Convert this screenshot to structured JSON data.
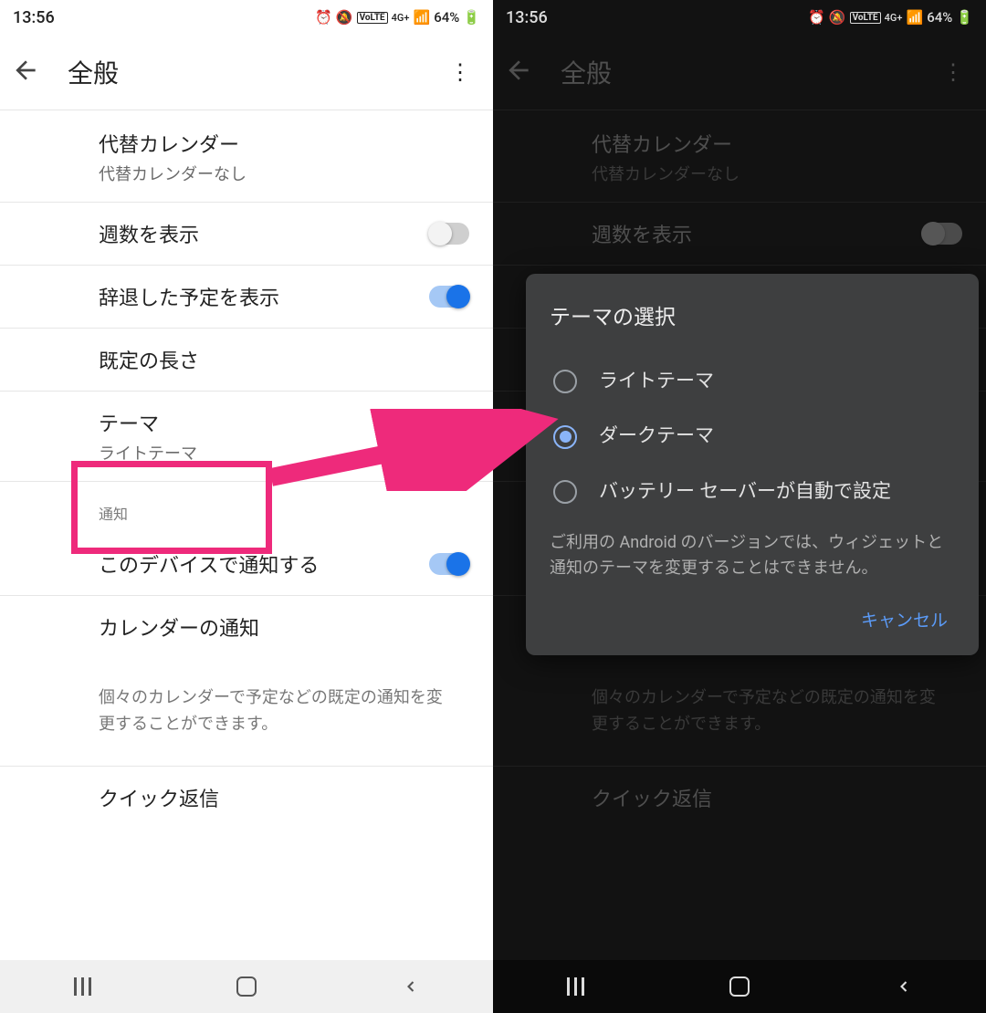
{
  "status": {
    "time": "13:56",
    "battery": "64%",
    "volte": "VoLTE",
    "net": "4G+"
  },
  "header": {
    "title": "全般"
  },
  "items": {
    "altcal": {
      "title": "代替カレンダー",
      "sub": "代替カレンダーなし"
    },
    "weeknum": {
      "title": "週数を表示"
    },
    "declined": {
      "title": "辞退した予定を表示"
    },
    "deflen": {
      "title": "既定の長さ"
    },
    "theme": {
      "title": "テーマ",
      "sub": "ライトテーマ"
    },
    "notify": {
      "title": "このデバイスで通知する"
    },
    "calnotify": {
      "title": "カレンダーの通知"
    },
    "quick": {
      "title": "クイック返信"
    }
  },
  "section": {
    "notifications": "通知"
  },
  "footer_text": "個々のカレンダーで予定などの既定の通知を変更することができます。",
  "dialog": {
    "title": "テーマの選択",
    "options": {
      "light": "ライトテーマ",
      "dark": "ダークテーマ",
      "auto": "バッテリー セーバーが自動で設定"
    },
    "note": "ご利用の Android のバージョンでは、ウィジェットと通知のテーマを変更することはできません。",
    "cancel": "キャンセル"
  }
}
